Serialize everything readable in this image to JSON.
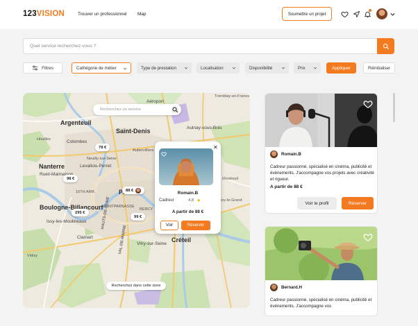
{
  "header": {
    "logo_main": "123",
    "logo_accent": "VISION",
    "nav": [
      {
        "label": "Trouver un professionnel"
      },
      {
        "label": "Map"
      }
    ],
    "cta_label": "Soumettre un projet",
    "icons": [
      "heart-icon",
      "send-icon",
      "bell-icon",
      "chevron-down-icon"
    ]
  },
  "search": {
    "placeholder": "Quel service recherchez-vous ?"
  },
  "filters": {
    "main_label": "Filtres",
    "items": [
      {
        "label": "Cathégorie de métier"
      },
      {
        "label": "Type de prestation"
      },
      {
        "label": "Localisation"
      },
      {
        "label": "Disponibilité"
      },
      {
        "label": "Prix"
      }
    ],
    "apply_label": "Appliquer",
    "reset_label": "Réinitialiser"
  },
  "map": {
    "search_placeholder": "Recherchez un service",
    "places": {
      "argenteuil": "Argenteuil",
      "saint_denis": "Saint-Denis",
      "nanterre": "Nanterre",
      "rueil": "Rueil-Malmaison",
      "colombes": "Colombes",
      "boulogne": "Boulogne-Billancourt",
      "issy": "Issy-les-Moulineaux",
      "clamart": "Clamart",
      "creteil": "Créteil",
      "vitry": "Vitry-sur-Seine",
      "aulnay": "Aulnay-sous-Bois",
      "tremblay": "Tremblay-en-France",
      "aeroport": "Aéroport",
      "paris": "Paris",
      "levallois": "Levallois-Perret",
      "neuilly": "Neuilly-sur-Seine",
      "montparnasse": "MONTPARNASSE",
      "arr16": "16TH ARR.",
      "hauts_de_seine": "HAUTS-DE-SEINE",
      "val_de_marne": "VAL-DE-MARNE",
      "aubervilliers": "Aubervilliers",
      "bercy": "BERCY",
      "houilles": "Houilles",
      "montreuil": "Montreuil",
      "noisy": "Noisy-le-Grand",
      "velizy": "Vélizy"
    },
    "price_markers": [
      {
        "label": "78 €"
      },
      {
        "label": "98 €"
      },
      {
        "label": "88 €"
      },
      {
        "label": "295 €"
      },
      {
        "label": "99 €"
      }
    ],
    "zone_button_label": "Recherchez dans cette zone",
    "popup": {
      "name": "Romain.B",
      "role": "Cadreur",
      "rating": "4,8",
      "star": "★",
      "price": "A partir de 88 €",
      "view_label": "Voir",
      "book_label": "Réserver",
      "close": "✕"
    }
  },
  "cards": [
    {
      "name": "Romain.B",
      "description": "Cadreur passionné, spécialisé en cinéma, publicité et événements. J'accompagne vos projets avec créativité et rigueur.",
      "price": "A partir de 88 €",
      "view_label": "Voir le profil",
      "book_label": "Réserver"
    },
    {
      "name": "Bernard.H",
      "description": "Cadreur passionné, spécialisé en cinéma, publicité et événements. J'accompagne vos",
      "price": "",
      "view_label": "",
      "book_label": ""
    }
  ],
  "colors": {
    "accent": "#f47a1f",
    "page_bg": "#f3f3f4"
  }
}
